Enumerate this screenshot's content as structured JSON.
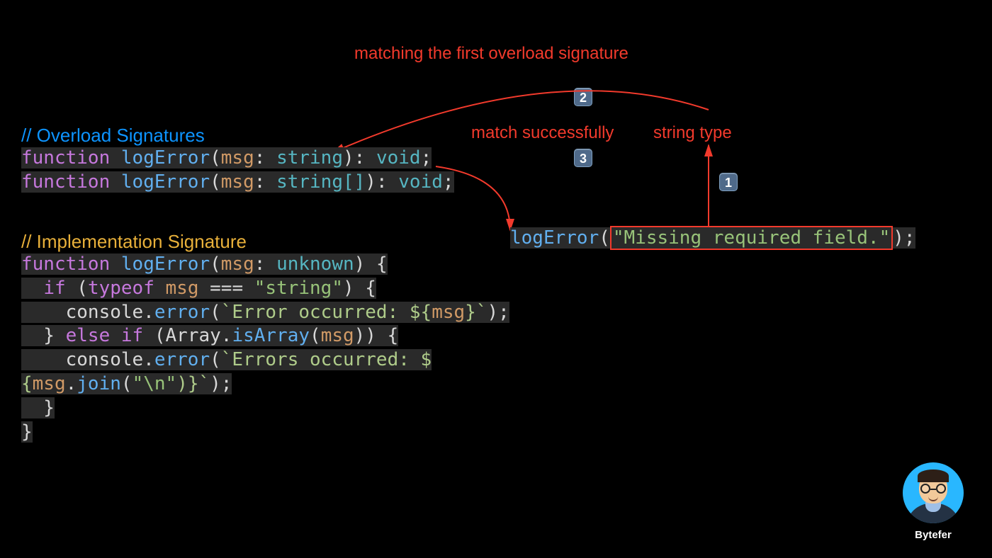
{
  "annotations": {
    "top": "matching the first overload signature",
    "match_success": "match successfully",
    "string_type": "string type"
  },
  "badges": {
    "b1": "1",
    "b2": "2",
    "b3": "3"
  },
  "comments": {
    "overload": "// Overload Signatures",
    "impl": "// Implementation Signature"
  },
  "code": {
    "sig1": {
      "kw": "function",
      "fn": "logError",
      "open": "(",
      "param": "msg",
      "colon": ": ",
      "type": "string",
      "close": "): ",
      "ret": "void",
      "semi": ";"
    },
    "sig2": {
      "kw": "function",
      "fn": "logError",
      "open": "(",
      "param": "msg",
      "colon": ": ",
      "type": "string[]",
      "close": "): ",
      "ret": "void",
      "semi": ";"
    },
    "impl": {
      "l1_kw": "function",
      "l1_fn": "logError",
      "l1_open": "(",
      "l1_param": "msg",
      "l1_colon": ": ",
      "l1_type": "unknown",
      "l1_close": ") {",
      "l2_if": "if",
      "l2_open": " (",
      "l2_typeof": "typeof",
      "l2_sp": " ",
      "l2_msg": "msg",
      "l2_eq": " === ",
      "l2_str": "\"string\"",
      "l2_close": ") {",
      "l3_a": "    console.",
      "l3_err": "error",
      "l3_b": "(",
      "l3_tmpl": "`Error occurred: ${",
      "l3_msg": "msg",
      "l3_end": "}`",
      "l3_c": ");",
      "l4_a": "  } ",
      "l4_else": "else",
      "l4_sp": " ",
      "l4_if": "if",
      "l4_b": " (Array.",
      "l4_fn": "isArray",
      "l4_c": "(",
      "l4_msg": "msg",
      "l4_d": ")) {",
      "l5_a": "    console.",
      "l5_err": "error",
      "l5_b": "(",
      "l5_tmpl": "`Errors occurred: $",
      "l6_a": "{",
      "l6_msg": "msg",
      "l6_b": ".",
      "l6_join": "join",
      "l6_c": "(",
      "l6_str": "\"\\n\"",
      "l6_d": ")}",
      "l6_end": "`",
      "l6_e": ");",
      "l7": "  }",
      "l8": "}"
    },
    "call": {
      "fn": "logError",
      "open": "(",
      "arg": "\"Missing required field.\"",
      "close": ");"
    }
  },
  "author": "Bytefer",
  "colors": {
    "red": "#f23a2c",
    "blue": "#0d94ff",
    "yellow": "#e8b03a"
  }
}
